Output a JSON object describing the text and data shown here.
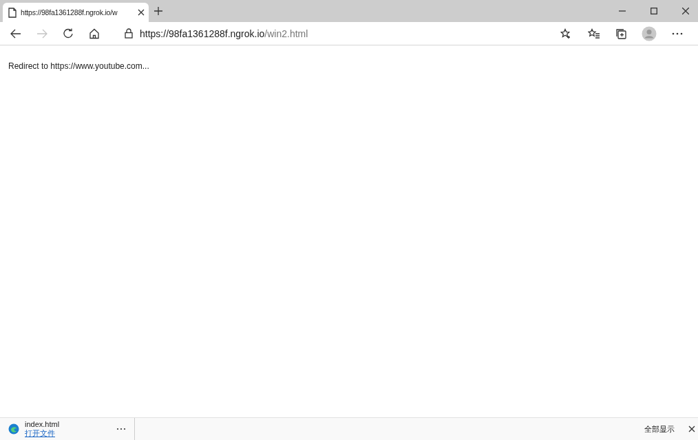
{
  "tabs": [
    {
      "title": "https://98fa1361288f.ngrok.io/w",
      "selected": true
    }
  ],
  "address_bar": {
    "host": "https://98fa1361288f.ngrok.io",
    "path": "/win2.html"
  },
  "toolbar": {
    "forward_disabled": true
  },
  "page": {
    "text": "Redirect to https://www.youtube.com..."
  },
  "downloads": [
    {
      "file": "index.html",
      "action": "打开文件"
    }
  ],
  "download_bar": {
    "show_all": "全部显示"
  }
}
